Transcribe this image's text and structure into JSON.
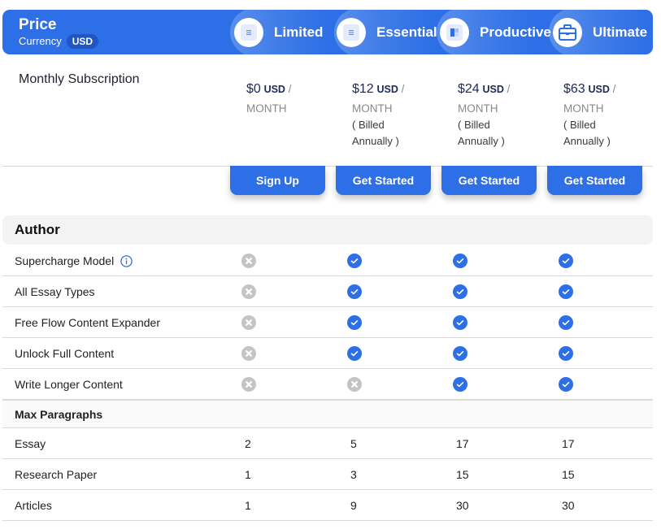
{
  "header": {
    "title": "Price",
    "currency_label": "Currency",
    "currency_value": "USD",
    "plans": [
      {
        "name": "Limited",
        "icon": "document-icon"
      },
      {
        "name": "Essential",
        "icon": "document-icon"
      },
      {
        "name": "Productive",
        "icon": "layout-icon"
      },
      {
        "name": "Ultimate",
        "icon": "briefcase-icon"
      }
    ]
  },
  "subscription": {
    "label": "Monthly Subscription",
    "prices": [
      {
        "amount": "$0",
        "currency": "USD",
        "slash": "/",
        "period": "MONTH",
        "billing_1": "",
        "billing_2": ""
      },
      {
        "amount": "$12",
        "currency": "USD",
        "slash": "/",
        "period": "MONTH",
        "billing_1": "( Billed",
        "billing_2": "Annually )"
      },
      {
        "amount": "$24",
        "currency": "USD",
        "slash": "/",
        "period": "MONTH",
        "billing_1": "( Billed",
        "billing_2": "Annually )"
      },
      {
        "amount": "$63",
        "currency": "USD",
        "slash": "/",
        "period": "MONTH",
        "billing_1": "( Billed",
        "billing_2": "Annually )"
      }
    ],
    "buttons": [
      "Sign Up",
      "Get Started",
      "Get Started",
      "Get Started"
    ]
  },
  "sections": {
    "author": {
      "title": "Author",
      "features": [
        {
          "label": "Supercharge Model",
          "info": true,
          "values": [
            false,
            true,
            true,
            true
          ]
        },
        {
          "label": "All Essay Types",
          "info": false,
          "values": [
            false,
            true,
            true,
            true
          ]
        },
        {
          "label": "Free Flow Content Expander",
          "info": false,
          "values": [
            false,
            true,
            true,
            true
          ]
        },
        {
          "label": "Unlock Full Content",
          "info": false,
          "values": [
            false,
            true,
            true,
            true
          ]
        },
        {
          "label": "Write Longer Content",
          "info": false,
          "values": [
            false,
            false,
            true,
            true
          ]
        }
      ]
    },
    "max_paragraphs": {
      "title": "Max Paragraphs",
      "rows": [
        {
          "label": "Essay",
          "values": [
            "2",
            "5",
            "17",
            "17"
          ]
        },
        {
          "label": "Research Paper",
          "values": [
            "1",
            "3",
            "15",
            "15"
          ]
        },
        {
          "label": "Articles",
          "values": [
            "1",
            "9",
            "30",
            "30"
          ]
        }
      ]
    }
  },
  "colors": {
    "accent": "#2d6fe6",
    "check": "#2d6fe6",
    "cross": "#c4c4c4",
    "section_bg": "#f3f3f3"
  }
}
